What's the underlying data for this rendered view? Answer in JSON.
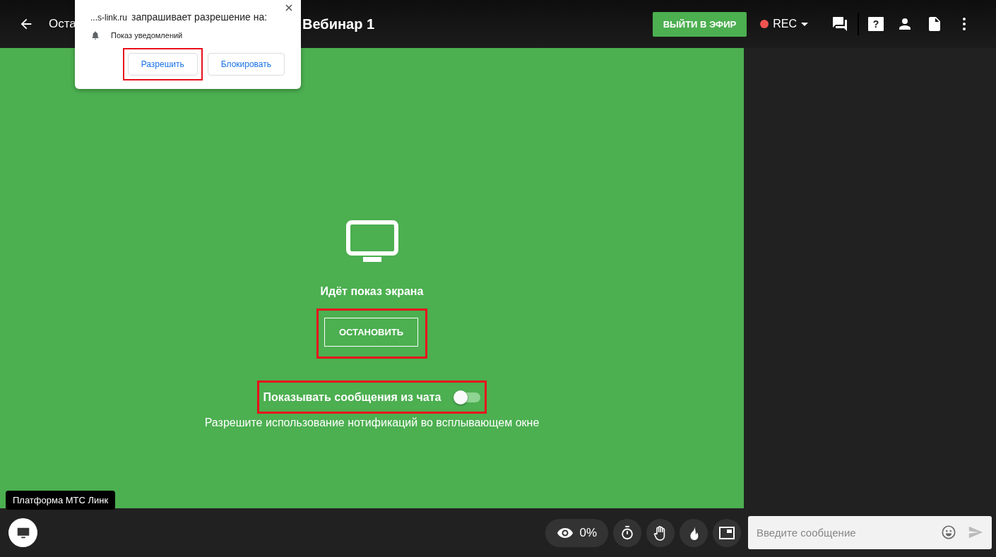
{
  "header": {
    "title_visible_part": "Оста",
    "webinar_title": "Вебинар 1",
    "go_live_button": "ВЫЙТИ В ЭФИР",
    "rec_label": "REC",
    "help_icon_glyph": "?"
  },
  "permission_popup": {
    "site": "...s-link.ru",
    "request": "запрашивает разрешение на:",
    "permission": "Показ уведомлений",
    "buttons": [
      {
        "label": "Разрешить",
        "highlighted": true
      },
      {
        "label": "Блокировать",
        "highlighted": false
      }
    ]
  },
  "screen_share": {
    "status": "Идёт показ экрана",
    "stop_button": {
      "label": "ОСТАНОВИТЬ",
      "highlighted": true
    },
    "chat_toggle": {
      "label": "Показывать сообщения из чата",
      "on": false,
      "highlighted": true
    },
    "hint": "Разрешите использование нотификаций во всплывающем окне"
  },
  "tooltip": "Платформа МТС Линк",
  "bottom_bar": {
    "viewers_percent": "0%"
  },
  "chat_input": {
    "placeholder": "Введите сообщение"
  }
}
